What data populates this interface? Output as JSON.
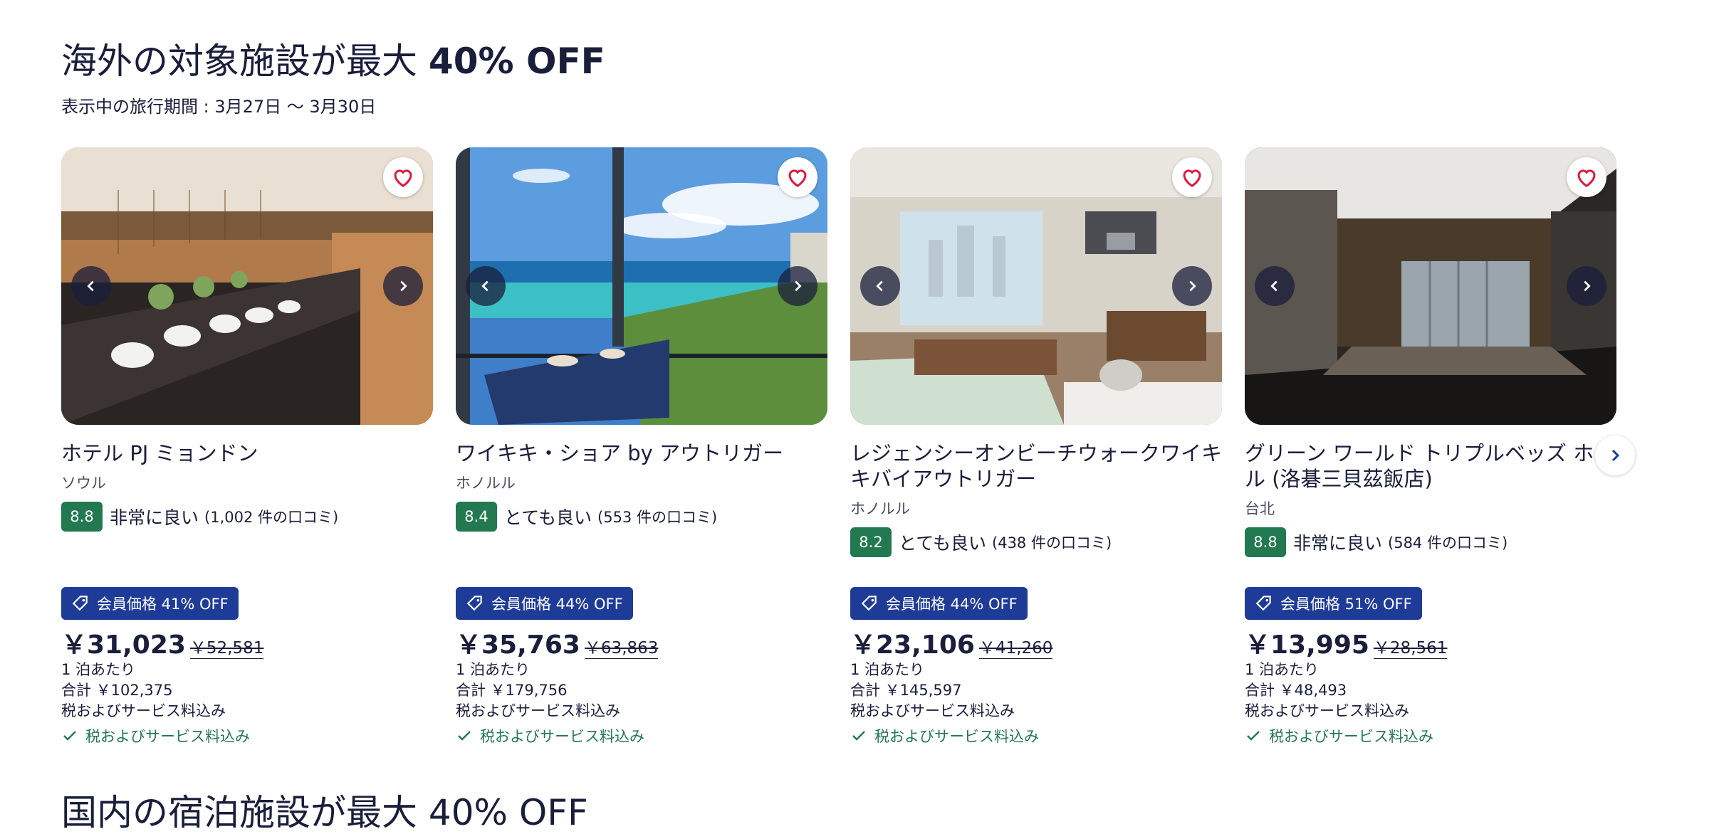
{
  "section": {
    "title_prefix": "海外の対象施設が最大 ",
    "title_bold": "40% OFF",
    "subtitle": "表示中の旅行期間 : 3月27日 〜 3月30日",
    "next_title": "国内の宿泊施設が最大 40% OFF"
  },
  "cards": [
    {
      "name": "ホテル PJ ミョンドン",
      "city": "ソウル",
      "score": "8.8",
      "rating_text": "非常に良い",
      "reviews": "(1,002 件の口コミ)",
      "badge": "会員価格 41% OFF",
      "price": "￥31,023",
      "old_price": "￥52,581",
      "per_night": "1 泊あたり",
      "total": "合計 ￥102,375",
      "tax_note": "税およびサービス料込み",
      "tax_check": "税およびサービス料込み"
    },
    {
      "name": "ワイキキ・ショア by アウトリガー",
      "city": "ホノルル",
      "score": "8.4",
      "rating_text": "とても良い",
      "reviews": "(553 件の口コミ)",
      "badge": "会員価格 44% OFF",
      "price": "￥35,763",
      "old_price": "￥63,863",
      "per_night": "1 泊あたり",
      "total": "合計 ￥179,756",
      "tax_note": "税およびサービス料込み",
      "tax_check": "税およびサービス料込み"
    },
    {
      "name": "レジェンシーオンビーチウォークワイキキバイアウトリガー",
      "city": "ホノルル",
      "score": "8.2",
      "rating_text": "とても良い",
      "reviews": "(438 件の口コミ)",
      "badge": "会員価格 44% OFF",
      "price": "￥23,106",
      "old_price": "￥41,260",
      "per_night": "1 泊あたり",
      "total": "合計 ￥145,597",
      "tax_note": "税およびサービス料込み",
      "tax_check": "税およびサービス料込み"
    },
    {
      "name": "グリーン ワールド トリプルベッズ ホテル (洛碁三貝茲飯店)",
      "city": "台北",
      "score": "8.8",
      "rating_text": "非常に良い",
      "reviews": "(584 件の口コミ)",
      "badge": "会員価格 51% OFF",
      "price": "￥13,995",
      "old_price": "￥28,561",
      "per_night": "1 泊あたり",
      "total": "合計 ￥48,493",
      "tax_note": "税およびサービス料込み",
      "tax_check": "税およびサービス料込み"
    }
  ],
  "icons": {
    "favorite": "heart-icon",
    "prev": "chevron-left-icon",
    "next": "chevron-right-icon",
    "tag": "tag-icon",
    "check": "check-icon"
  },
  "colors": {
    "text": "#191e3b",
    "score_bg": "#227950",
    "badge_bg": "#1e3b98",
    "heart": "#e3173e",
    "check": "#227950"
  }
}
